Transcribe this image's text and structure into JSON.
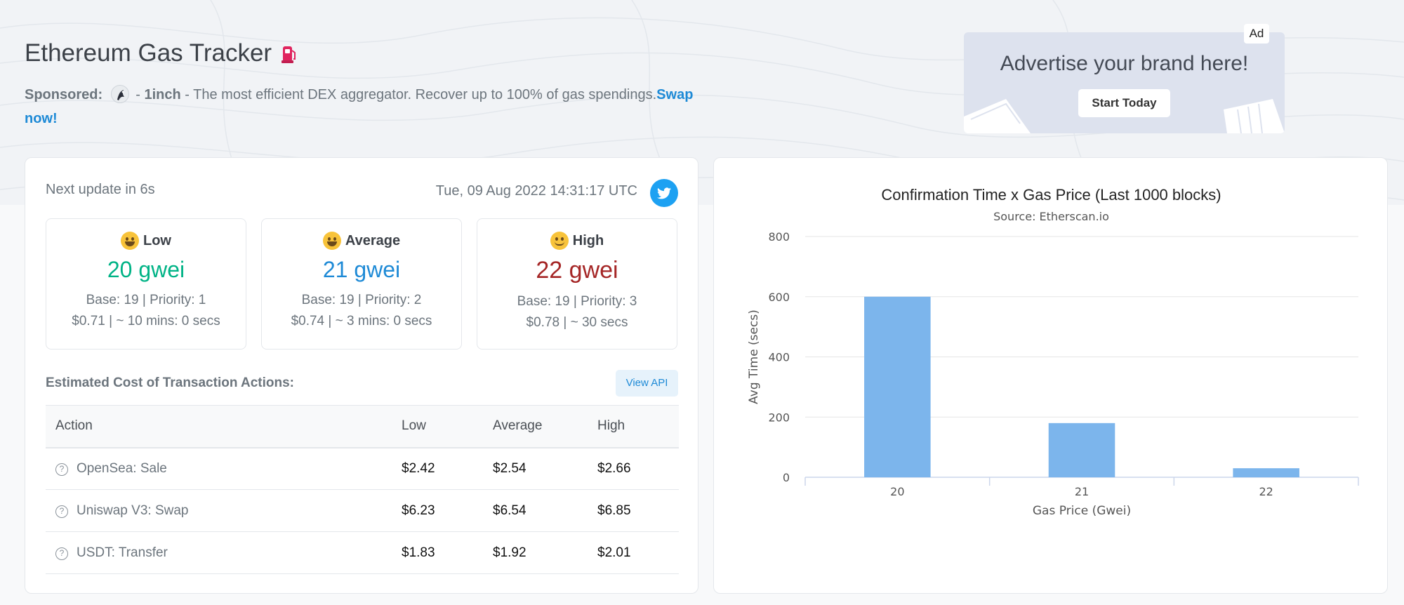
{
  "header": {
    "title": "Ethereum Gas Tracker",
    "sponsored_label": "Sponsored:",
    "sponsor_name": "1inch",
    "sponsor_text": "- The most efficient DEX aggregator. Recover up to 100% of gas spendings.",
    "sponsor_link": "Swap now!",
    "sponsor_dash": "-"
  },
  "ad": {
    "headline": "Advertise your brand here!",
    "button": "Start Today",
    "tag": "Ad"
  },
  "status": {
    "next_update": "Next update in 6s",
    "timestamp": "Tue, 09 Aug 2022 14:31:17 UTC"
  },
  "gas": [
    {
      "label": "Low",
      "price": "20 gwei",
      "base": "Base: 19 | Priority: 1",
      "cost": "$0.71 | ~ 10 mins: 0 secs",
      "color": "#00b386"
    },
    {
      "label": "Average",
      "price": "21 gwei",
      "base": "Base: 19 | Priority: 2",
      "cost": "$0.74 | ~ 3 mins: 0 secs",
      "color": "#1e8ad6"
    },
    {
      "label": "High",
      "price": "22 gwei",
      "base": "Base: 19 | Priority: 3",
      "cost": "$0.78 | ~ 30 secs",
      "color": "#a52626"
    }
  ],
  "estimates": {
    "title": "Estimated Cost of Transaction Actions:",
    "api_button": "View API",
    "columns": [
      "Action",
      "Low",
      "Average",
      "High"
    ],
    "rows": [
      {
        "action": "OpenSea: Sale",
        "low": "$2.42",
        "average": "$2.54",
        "high": "$2.66"
      },
      {
        "action": "Uniswap V3: Swap",
        "low": "$6.23",
        "average": "$6.54",
        "high": "$6.85"
      },
      {
        "action": "USDT: Transfer",
        "low": "$1.83",
        "average": "$1.92",
        "high": "$2.01"
      }
    ]
  },
  "chart_data": {
    "type": "bar",
    "title": "Confirmation Time x Gas Price (Last 1000 blocks)",
    "subtitle": "Source: Etherscan.io",
    "xlabel": "Gas Price (Gwei)",
    "ylabel": "Avg Time (secs)",
    "categories": [
      "20",
      "21",
      "22"
    ],
    "values": [
      600,
      180,
      30
    ],
    "ylim": [
      0,
      800
    ],
    "yticks": [
      "0",
      "200",
      "400",
      "600",
      "800"
    ],
    "grid": true,
    "bar_color": "#7cb5ec"
  }
}
